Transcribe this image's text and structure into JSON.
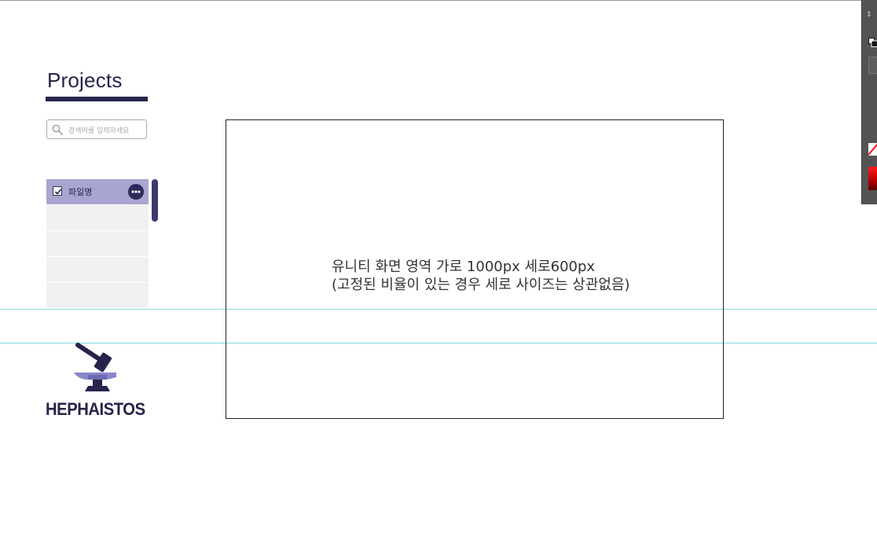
{
  "sidebar": {
    "title": "Projects",
    "search_placeholder": "검색어를 입력하세요",
    "files": [
      {
        "name": "파일명",
        "checked": true,
        "selected": true
      },
      {
        "name": ""
      },
      {
        "name": ""
      },
      {
        "name": ""
      },
      {
        "name": ""
      }
    ]
  },
  "logo": {
    "text": "HEPHAISTOS"
  },
  "unity_area": {
    "line1": "유니티 화면 영역 가로 1000px  세로600px",
    "line2": "(고정된 비율이 있는 경우 세로 사이즈는 상관없음)"
  },
  "colors": {
    "brand": "#26244a",
    "selected_row": "#a8a6d0",
    "guide": "#7fdcdc"
  }
}
